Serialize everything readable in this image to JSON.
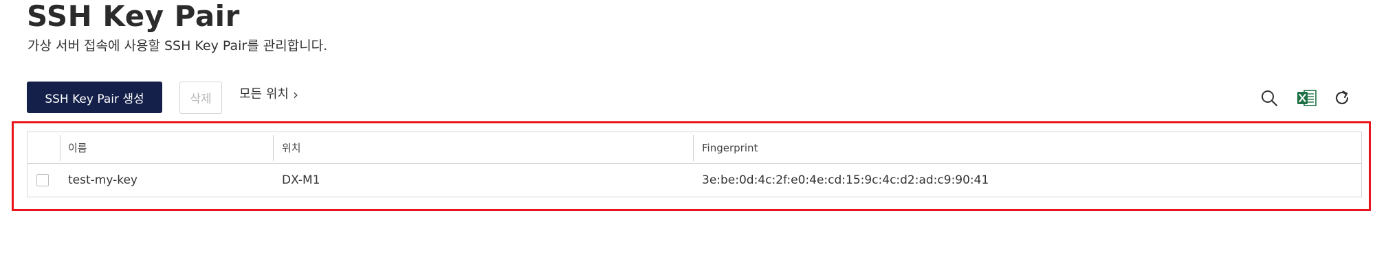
{
  "page": {
    "title": "SSH Key Pair",
    "description": "가상 서버 접속에 사용할 SSH Key Pair를 관리합니다."
  },
  "toolbar": {
    "create_label": "SSH Key Pair 생성",
    "delete_label": "삭제",
    "location_label": "모든 위치",
    "location_chevron": "›",
    "icons": [
      "search-icon",
      "excel-export-icon",
      "refresh-icon"
    ],
    "excel_color": "#1e7145"
  },
  "table": {
    "columns": [
      "이름",
      "위치",
      "Fingerprint"
    ],
    "rows": [
      {
        "name": "test-my-key",
        "location": "DX-M1",
        "fingerprint": "3e:be:0d:4c:2f:e0:4e:cd:15:9c:4c:d2:ad:c9:90:41"
      }
    ]
  },
  "colors": {
    "primary_button": "#14204a",
    "highlight": "#e8151b"
  }
}
